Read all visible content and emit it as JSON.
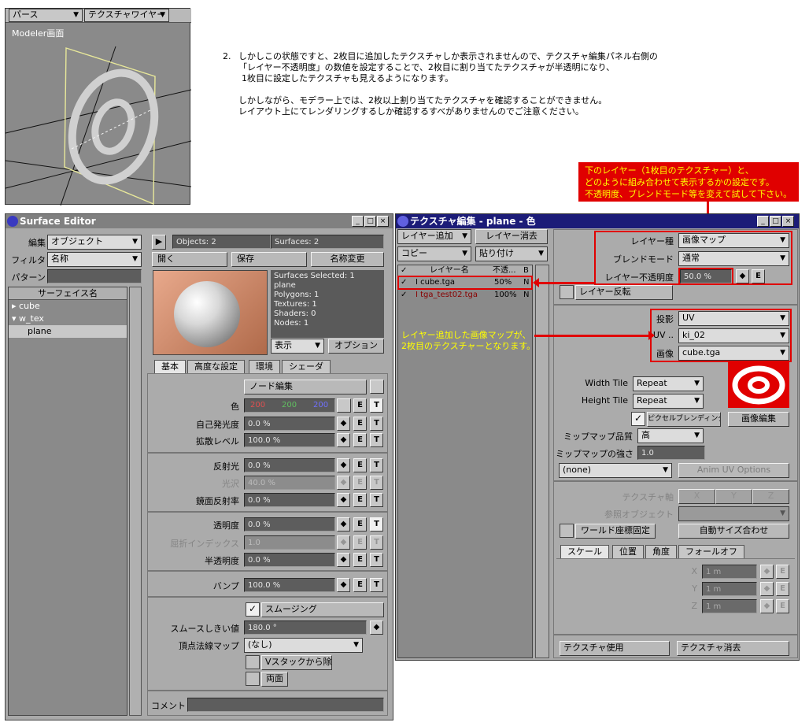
{
  "viewport": {
    "mode": "パース",
    "display": "テクスチャワイヤー",
    "caption": "Modeler画面"
  },
  "explanation": {
    "step": "2.",
    "lines": [
      "しかしこの状態ですと、2枚目に追加したテクスチャしか表示されませんので、テクスチャ編集パネル右側の",
      "「レイヤー不透明度」の数値を設定することで、2枚目に割り当てたテクスチャが半透明になり、",
      "1枚目に設定したテクスチャも見えるようになります。",
      "",
      "しかしながら、モデラー上では、2枚以上割り当てたテクスチャを確認することができません。",
      "レイアウト上にてレンダリングするしか確認するすべがありませんのでご注意ください。"
    ]
  },
  "callouts": {
    "top_lines": [
      "下のレイヤー（1枚目のテクスチャー）と、",
      "どのように組み合わせて表示するかの設定です。",
      "不透明度、ブレンドモード等を変えて試して下さい。"
    ],
    "mid_lines": [
      "レイヤー追加した画像マップが、",
      "2枚目のテクスチャーとなります。"
    ]
  },
  "surface_editor": {
    "title": "Surface Editor",
    "edit_label": "編集",
    "edit_value": "オブジェクト",
    "filter_label": "フィルタ",
    "filter_value": "名称",
    "pattern_label": "パターン",
    "list_header": "サーフェイス名",
    "tree": [
      "cube",
      "w_tex",
      "plane"
    ],
    "objects": "Objects: 2",
    "surfaces": "Surfaces: 2",
    "btn_open": "開く",
    "btn_save": "保存",
    "btn_rename": "名称変更",
    "info": [
      "Surfaces Selected: 1",
      "plane",
      "Polygons: 1",
      "Textures: 1",
      "Shaders: 0",
      "Nodes: 1"
    ],
    "display": "表示",
    "options": "オプション",
    "tabs": [
      "基本",
      "高度な設定",
      "環境",
      "シェーダ"
    ],
    "node_edit": "ノード編集",
    "color_label": "色",
    "color": [
      "200",
      "200",
      "200"
    ],
    "rows1": [
      {
        "label": "自己発光度",
        "value": "0.0 %"
      },
      {
        "label": "拡散レベル",
        "value": "100.0 %"
      }
    ],
    "rows2": [
      {
        "label": "反射光",
        "value": "0.0 %"
      },
      {
        "label": "光沢",
        "value": "40.0 %"
      },
      {
        "label": "鏡面反射率",
        "value": "0.0 %"
      }
    ],
    "rows3": [
      {
        "label": "透明度",
        "value": "0.0 %"
      },
      {
        "label": "屈折インデックス",
        "value": "1.0"
      },
      {
        "label": "半透明度",
        "value": "0.0 %"
      }
    ],
    "bump": {
      "label": "バンプ",
      "value": "100.0 %"
    },
    "smoothing": "スムージング",
    "smooth_thr": {
      "label": "スムースしきい値",
      "value": "180.0 °"
    },
    "vertex_map": {
      "label": "頂点法線マップ",
      "value": "(なし)"
    },
    "vstack": "Vスタックから除外",
    "double": "両面",
    "comment": "コメント",
    "e": "E",
    "t": "T"
  },
  "texture_editor": {
    "title": "テクスチャ編集 - plane - 色",
    "add_layer": "レイヤー追加",
    "del_layer": "レイヤー消去",
    "copy": "コピー",
    "paste": "貼り付け",
    "col_name": "レイヤー名",
    "col_opacity": "不透...",
    "col_blend": "B",
    "layers": [
      {
        "name": "I cube.tga",
        "opacity": "50%",
        "blend": "N"
      },
      {
        "name": "I tga_test02.tga",
        "opacity": "100%",
        "blend": "N"
      }
    ],
    "layer_type_label": "レイヤー種",
    "layer_type": "画像マップ",
    "blend_label": "ブレンドモード",
    "blend": "通常",
    "opacity_label": "レイヤー不透明度",
    "opacity": "50.0 %",
    "invert": "レイヤー反転",
    "proj_label": "投影",
    "proj": "UV",
    "uv_label": "UV ..",
    "uv": "ki_02",
    "image_label": "画像",
    "image": "cube.tga",
    "wtile_label": "Width Tile",
    "wtile": "Repeat",
    "htile_label": "Height Tile",
    "htile": "Repeat",
    "pixel_blend": "ピクセルブレンディング",
    "image_edit": "画像編集",
    "mip_q_label": "ミップマップ品質",
    "mip_q": "高",
    "mip_s_label": "ミップマップの強さ",
    "mip_s": "1.0",
    "none": "(none)",
    "anim_uv": "Anim UV Options",
    "axis_label": "テクスチャ軸",
    "axes": [
      "X",
      "Y",
      "Z"
    ],
    "ref_label": "参照オブジェクト",
    "world": "ワールド座標固定",
    "auto": "自動サイズ合わせ",
    "tabs": [
      "スケール",
      "位置",
      "角度",
      "フォールオフ"
    ],
    "xyz": [
      {
        "axis": "X",
        "value": "1 m"
      },
      {
        "axis": "Y",
        "value": "1 m"
      },
      {
        "axis": "Z",
        "value": "1 m"
      }
    ],
    "use": "テクスチャ使用",
    "clear": "テクスチャ消去",
    "e": "E"
  },
  "colors": {
    "accent": "#e00000",
    "callout_text": "#ffff00",
    "title_bar": "#1c1c78"
  }
}
